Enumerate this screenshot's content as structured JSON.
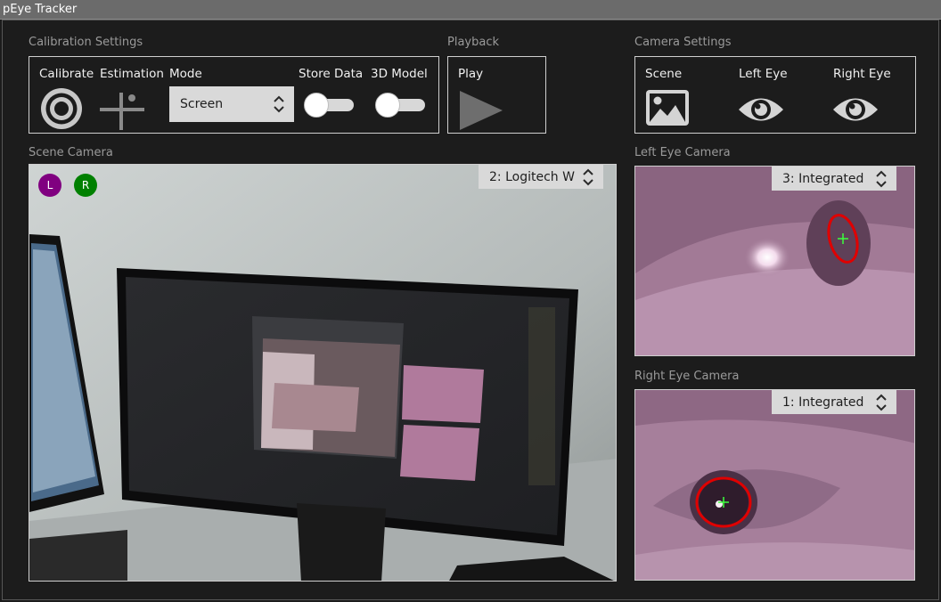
{
  "app": {
    "title": "pEye Tracker"
  },
  "calibration": {
    "section_label": "Calibration Settings",
    "calibrate_label": "Calibrate",
    "estimation_label": "Estimation",
    "mode_label": "Mode",
    "mode_value": "Screen",
    "store_data_label": "Store Data",
    "model_3d_label": "3D Model",
    "store_data_on": false,
    "model_3d_on": false
  },
  "playback": {
    "section_label": "Playback",
    "play_label": "Play"
  },
  "camera_settings": {
    "section_label": "Camera Settings",
    "scene_label": "Scene",
    "left_eye_label": "Left Eye",
    "right_eye_label": "Right Eye"
  },
  "scene_camera": {
    "section_label": "Scene Camera",
    "source": "2: Logitech W",
    "badge_left": "L",
    "badge_right": "R"
  },
  "left_eye_camera": {
    "section_label": "Left Eye Camera",
    "source": "3: Integrated"
  },
  "right_eye_camera": {
    "section_label": "Right Eye Camera",
    "source": "1: Integrated"
  },
  "colors": {
    "badge_left": "#800080",
    "badge_right": "#008000",
    "pupil_ellipse": "#e00000",
    "pupil_cross": "#3cff3c"
  }
}
